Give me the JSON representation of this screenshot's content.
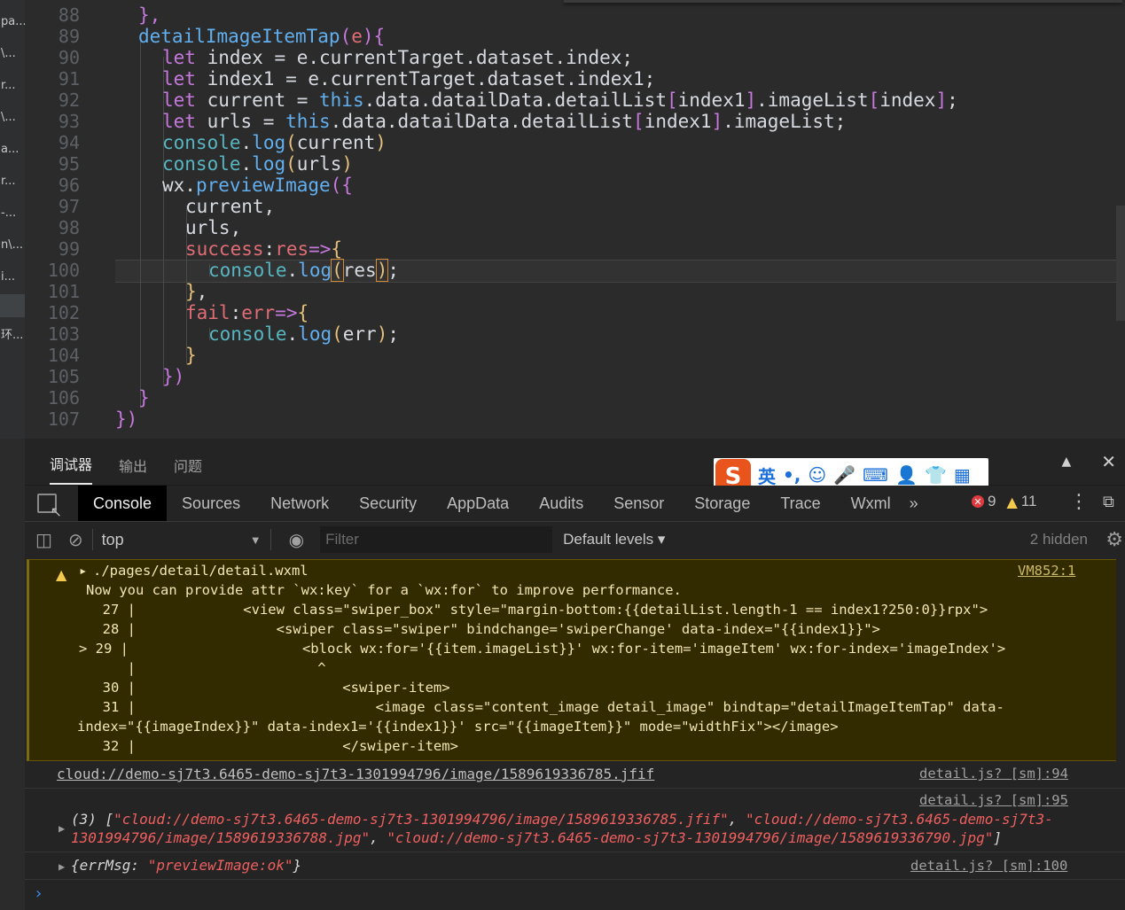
{
  "sidebar": {
    "items": [
      "pa...",
      "\\...",
      "r...",
      "\\...",
      "a...",
      "r...",
      "-...",
      "n\\...",
      "i...",
      "",
      "环..."
    ]
  },
  "editor": {
    "line_numbers": [
      "88",
      "89",
      "90",
      "91",
      "92",
      "93",
      "94",
      "95",
      "96",
      "97",
      "98",
      "99",
      "100",
      "101",
      "102",
      "103",
      "104",
      "105",
      "106",
      "107"
    ]
  },
  "devtools": {
    "panel_tabs": [
      "调试器",
      "输出",
      "问题"
    ],
    "ime": {
      "logo": "S",
      "lang": "英",
      "punct": "•,",
      "emoji": "☺",
      "mic": "🎤",
      "keyboard": "⌨",
      "user": "👤",
      "skin": "👕",
      "apps": "▦"
    },
    "tool_tabs": [
      "Console",
      "Sources",
      "Network",
      "Security",
      "AppData",
      "Audits",
      "Sensor",
      "Storage",
      "Trace",
      "Wxml"
    ],
    "more": "»",
    "error_count": "9",
    "warning_count": "11",
    "context": "top",
    "filter_placeholder": "Filter",
    "levels": "Default levels ▾",
    "hidden": "2 hidden",
    "collapse": "▲",
    "close": "✕"
  },
  "console": {
    "warn": {
      "file": "./pages/detail/detail.wxml",
      "source": "VM852:1",
      "message": "Now you can provide attr `wx:key` for a `wx:for` to improve performance.",
      "lines": [
        "  27 |             <view class=\"swiper_box\" style=\"margin-bottom:{{detailList.length-1 == index1?250:0}}rpx\">",
        "  28 |                 <swiper class=\"swiper\" bindchange='swiperChange' data-index=\"{{index1}}\">",
        "> 29 |                     <block wx:for='{{item.imageList}}' wx:for-item='imageItem' wx:for-index='imageIndex'>",
        "     |                      ^",
        "  30 |                         <swiper-item>",
        "  31 |                             <image class=\"content_image detail_image\" bindtap=\"detailImageItemTap\" data-",
        "index=\"{{imageIndex}}\" data-index1='{{index1}}' src=\"{{imageItem}}\" mode=\"widthFix\"></image>",
        "  32 |                         </swiper-item>"
      ]
    },
    "log1": {
      "text": "cloud://demo-sj7t3.6465-demo-sj7t3-1301994796/image/1589619336785.jfif",
      "source": "detail.js? [sm]:94"
    },
    "log2": {
      "source": "detail.js? [sm]:95",
      "count": "(3) [",
      "items": [
        "\"cloud://demo-sj7t3.6465-demo-sj7t3-1301994796/image/1589619336785.jfif\"",
        "\"cloud://demo-sj7t3.6465-demo-sj7t3-",
        "1301994796/image/1589619336788.jpg\"",
        "\"cloud://demo-sj7t3.6465-demo-sj7t3-1301994796/image/1589619336790.jpg\""
      ],
      "sep": ", ",
      "close": "]"
    },
    "log3": {
      "key": "{errMsg: ",
      "value": "\"previewImage:ok\"",
      "close": "}",
      "source": "detail.js? [sm]:100"
    },
    "prompt": "›"
  }
}
